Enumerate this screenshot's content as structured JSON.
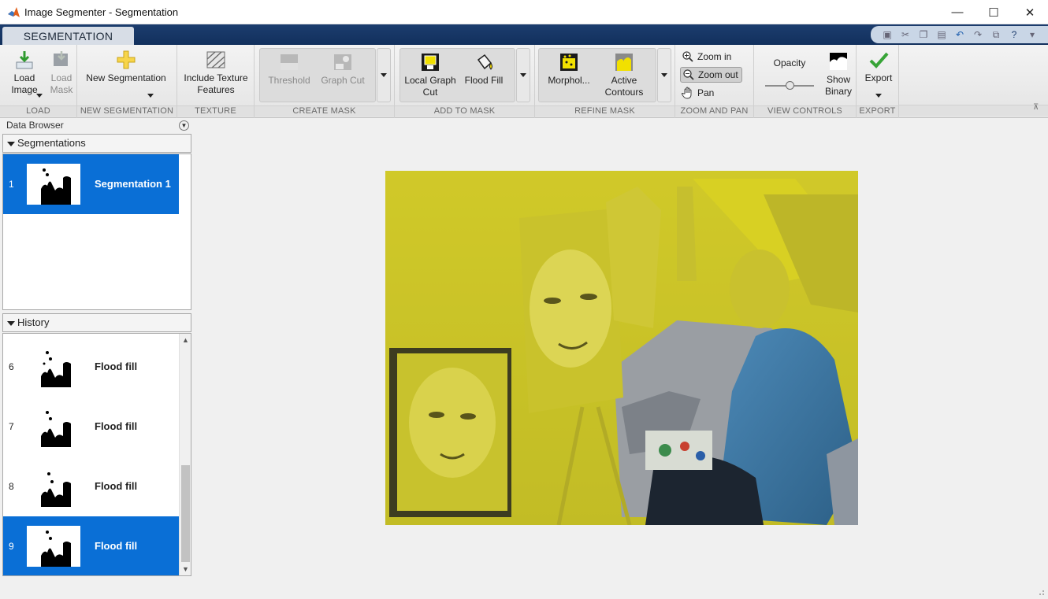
{
  "window": {
    "title": "Image Segmenter - Segmentation",
    "minimize": "—",
    "maximize": "☐",
    "close": "✕"
  },
  "tabs": [
    "SEGMENTATION"
  ],
  "toolbar": {
    "load": {
      "label": "LOAD",
      "load_image": "Load Image",
      "load_mask": "Load Mask"
    },
    "new_segmentation": {
      "label": "NEW SEGMENTATION",
      "button": "New Segmentation"
    },
    "texture": {
      "label": "TEXTURE",
      "button": "Include Texture Features"
    },
    "create_mask": {
      "label": "CREATE MASK",
      "threshold": "Threshold",
      "graph_cut": "Graph Cut"
    },
    "add_to_mask": {
      "label": "ADD TO MASK",
      "local_graph_cut": "Local Graph Cut",
      "flood_fill": "Flood Fill"
    },
    "refine_mask": {
      "label": "REFINE MASK",
      "morphology": "Morphol...",
      "active_contours": "Active Contours"
    },
    "zoom_pan": {
      "label": "ZOOM AND PAN",
      "zoom_in": "Zoom in",
      "zoom_out": "Zoom out",
      "pan": "Pan"
    },
    "view_controls": {
      "label": "VIEW CONTROLS",
      "opacity": "Opacity",
      "opacity_value": 0.5,
      "show_binary": "Show Binary"
    },
    "export": {
      "label": "EXPORT",
      "button": "Export"
    }
  },
  "data_browser": {
    "title": "Data Browser",
    "segmentations_header": "Segmentations",
    "segmentations": [
      {
        "index": "1",
        "name": "Segmentation 1",
        "selected": true
      }
    ],
    "history_header": "History",
    "history": [
      {
        "index": "6",
        "name": "Flood fill",
        "selected": false
      },
      {
        "index": "7",
        "name": "Flood fill",
        "selected": false
      },
      {
        "index": "8",
        "name": "Flood fill",
        "selected": false
      },
      {
        "index": "9",
        "name": "Flood fill",
        "selected": true
      }
    ]
  },
  "colors": {
    "selection": "#0a6fd6",
    "mask_overlay": "#d6d21e",
    "ribbon_header": "#1c3d6e"
  }
}
